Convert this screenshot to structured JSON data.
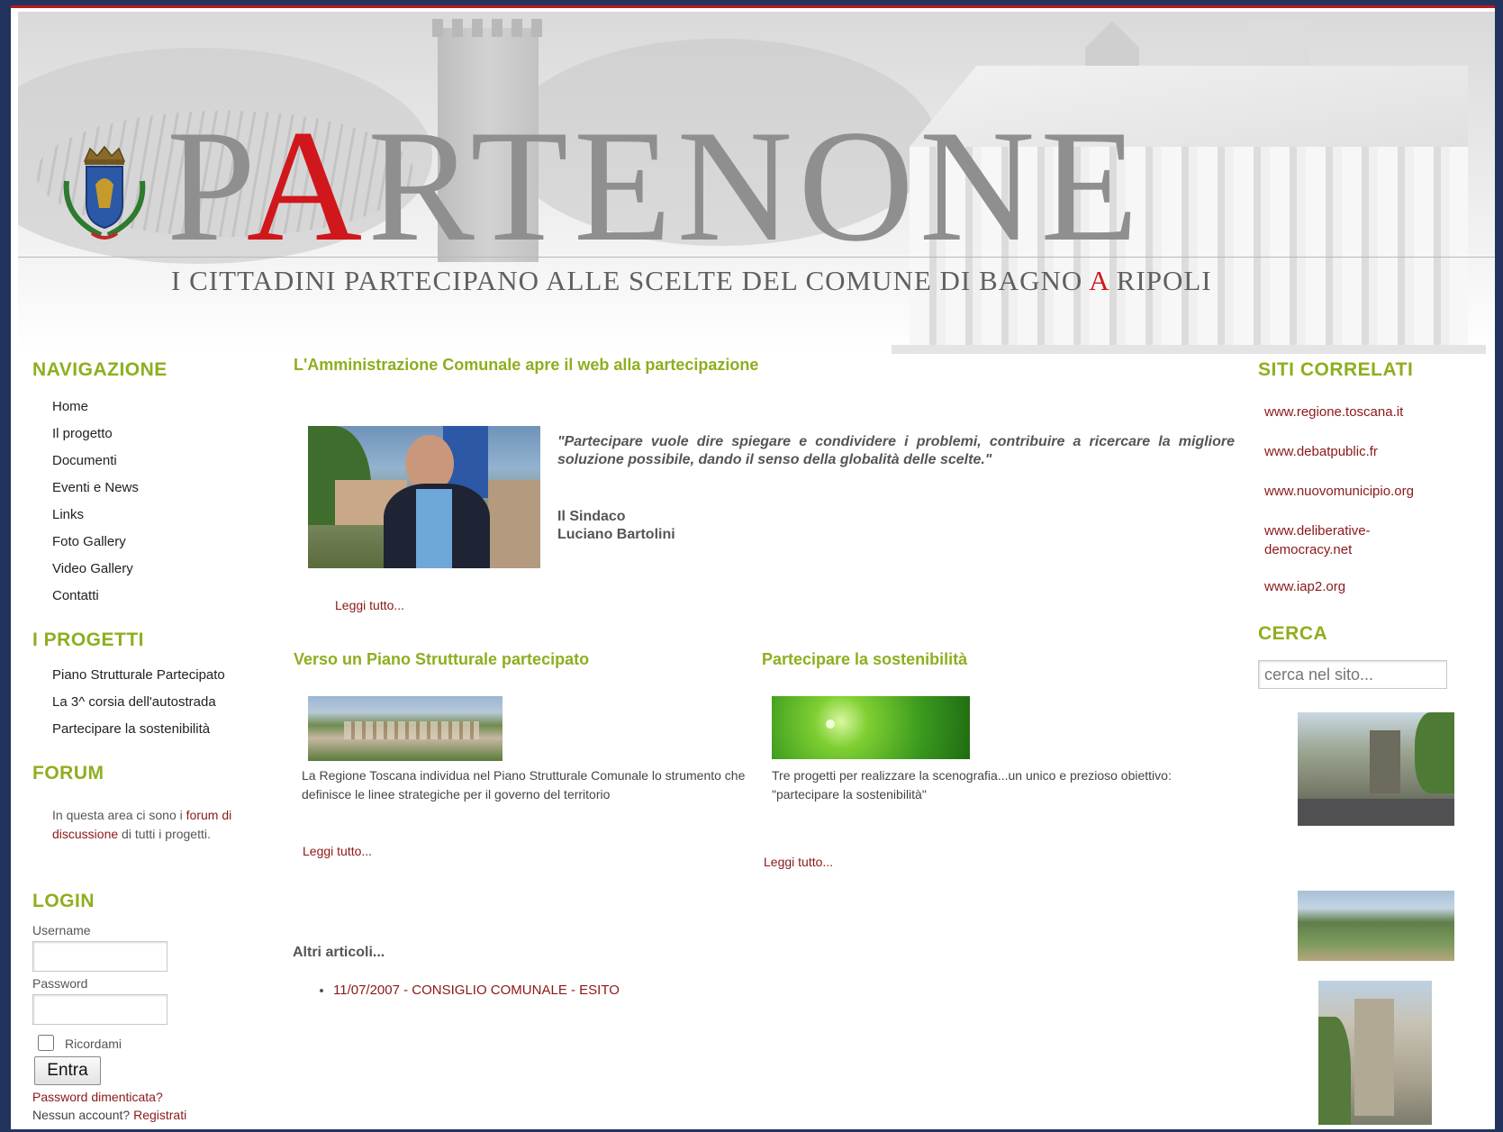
{
  "header": {
    "title_accent": "A",
    "title_before": "P",
    "title_after": "RTENONE",
    "tagline_before": "I CITTADINI PARTECIPANO ALLE SCELTE DEL COMUNE DI BAGNO ",
    "tagline_accent": "A",
    "tagline_after": " RIPOLI"
  },
  "sidebar": {
    "nav_title": "NAVIGAZIONE",
    "nav_items": [
      "Home",
      "Il progetto",
      "Documenti",
      "Eventi e News",
      "Links",
      "Foto Gallery",
      "Video Gallery",
      "Contatti"
    ],
    "progetti_title": "I PROGETTI",
    "progetti_items": [
      "Piano Strutturale Partecipato",
      "La 3^ corsia dell'autostrada",
      "Partecipare la sostenibilità"
    ],
    "forum_title": "FORUM",
    "forum_text_1": "In questa area ci sono i ",
    "forum_link": "forum di discussione",
    "forum_text_2": " di tutti i progetti.",
    "login_title": "LOGIN",
    "username_label": "Username",
    "password_label": "Password",
    "remember_label": "Ricordami",
    "submit_label": "Entra",
    "forgot_link": "Password dimenticata?",
    "no_account": "Nessun account? ",
    "register_link": "Registrati"
  },
  "main": {
    "lead_title": "L'Amministrazione Comunale apre il web alla partecipazione",
    "lead_quote": "\"Partecipare vuole dire spiegare e condividere i problemi, contribuire a ricercare la migliore soluzione possibile, dando il senso della globalità delle scelte.\"",
    "lead_author_role": "Il Sindaco",
    "lead_author_name": "Luciano Bartolini",
    "lead_read_more": "Leggi tutto...",
    "article1_title": "Verso un Piano Strutturale partecipato",
    "article1_text": "La Regione Toscana individua nel Piano Strutturale Comunale lo strumento che definisce le linee strategiche per il governo del territorio",
    "article1_read_more": "Leggi tutto...",
    "article2_title": "Partecipare la sostenibilità",
    "article2_text": "Tre progetti per realizzare la scenografia...un unico e prezioso obiettivo: \"partecipare la sostenibilità\"",
    "article2_read_more": "Leggi tutto...",
    "other_title": "Altri articoli...",
    "other_items": [
      "11/07/2007 - CONSIGLIO COMUNALE - ESITO"
    ]
  },
  "right": {
    "related_title": "SITI CORRELATI",
    "related_links": [
      "www.regione.toscana.it",
      "www.debatpublic.fr",
      "www.nuovomunicipio.org",
      "www.deliberative-democracy.net",
      "www.iap2.org"
    ],
    "search_title": "CERCA",
    "search_placeholder": "cerca nel sito..."
  },
  "colors": {
    "accent_red": "#d0171c",
    "section_green": "#8eae1f",
    "link_red": "#8b1818",
    "frame_navy": "#22335e"
  }
}
